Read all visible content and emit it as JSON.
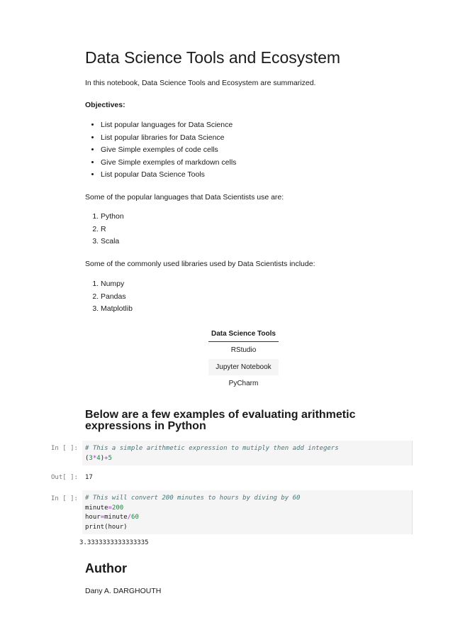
{
  "title": "Data Science Tools and Ecosystem",
  "intro": "In this notebook, Data Science Tools and Ecosystem are summarized.",
  "objectives": {
    "heading": "Objectives:",
    "items": [
      "List popular languages for Data Science",
      "List popular libraries for Data Science",
      "Give Simple exemples of code cells",
      "Give Simple exemples of markdown cells",
      "List popular Data Science Tools"
    ]
  },
  "languages": {
    "intro": "Some of the popular languages that Data Scientists use are:",
    "items": [
      "Python",
      "R",
      "Scala"
    ]
  },
  "libraries": {
    "intro": "Some of the commonly used libraries used by Data Scientists include:",
    "items": [
      "Numpy",
      "Pandas",
      "Matplotlib"
    ]
  },
  "tools_table": {
    "header": "Data Science Tools",
    "rows": [
      "RStudio",
      "Jupyter Notebook",
      "PyCharm"
    ]
  },
  "arith_heading": "Below are a few examples of evaluating arithmetic expressions in Python",
  "cell1": {
    "prompt": "In [ ]:",
    "comment": "# This a simple arithmetic expression to mutiply then add integers",
    "code_open": "(",
    "n1": "3",
    "op1": "*",
    "n2": "4",
    "code_close": ")",
    "op2": "+",
    "n3": "5"
  },
  "out1": {
    "prompt": "Out[ ]:",
    "value": "17"
  },
  "cell2": {
    "prompt": "In [ ]:",
    "comment": "# This will convert 200 minutes to hours by diving by 60",
    "line2_var": "minute",
    "line2_eq": "=",
    "line2_num": "200",
    "line3_var": "hour",
    "line3_eq": "=",
    "line3_var2": "minute",
    "line3_op": "/",
    "line3_num": "60",
    "line4": "print(hour)"
  },
  "out2": {
    "value": "3.3333333333333335"
  },
  "author": {
    "heading": "Author",
    "name": "Dany A. DARGHOUTH"
  }
}
